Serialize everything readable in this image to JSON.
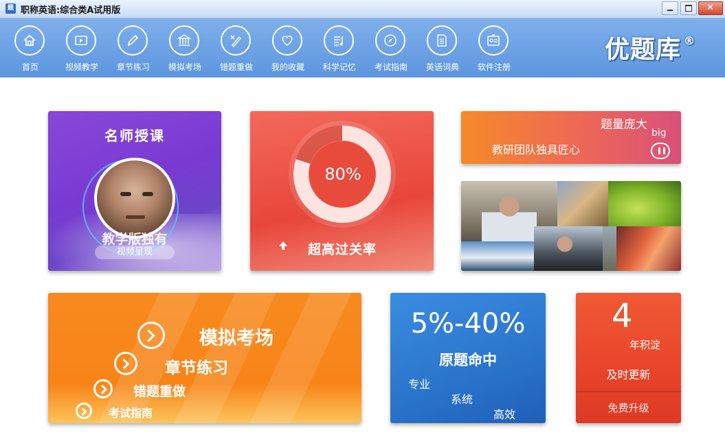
{
  "window": {
    "title": "职称英语:综合类A试用版",
    "app_icon_text": "题"
  },
  "nav": [
    {
      "label": "首页",
      "icon": "home-icon"
    },
    {
      "label": "视频教学",
      "icon": "video-icon"
    },
    {
      "label": "章节练习",
      "icon": "pencil-icon"
    },
    {
      "label": "模拟考场",
      "icon": "building-icon"
    },
    {
      "label": "错题重做",
      "icon": "wrong-answer-icon"
    },
    {
      "label": "我的收藏",
      "icon": "heart-icon"
    },
    {
      "label": "科学记忆",
      "icon": "list-icon"
    },
    {
      "label": "考试指南",
      "icon": "compass-icon"
    },
    {
      "label": "英语词典",
      "icon": "document-icon"
    },
    {
      "label": "软件注册",
      "icon": "id-card-icon"
    }
  ],
  "logo": {
    "text": "优题库",
    "mark": "®"
  },
  "tiles": {
    "teacher": {
      "title": "名师授课",
      "subtitle": "教学版独有",
      "pill": "视频呈现"
    },
    "pass_rate": {
      "percent_label": "80%",
      "percent": 80,
      "caption": "超高过关率"
    },
    "banner": {
      "line1": "题量庞大",
      "line1_suffix": "big",
      "line2": "教研团队独具匠心"
    },
    "practice": {
      "items": [
        "模拟考场",
        "章节练习",
        "错题重做",
        "考试指南"
      ]
    },
    "hit_rate": {
      "range": "5%-40%",
      "caption": "原题命中",
      "words": [
        "专业",
        "系统",
        "高效"
      ]
    },
    "update": {
      "number": "4",
      "unit": "年积淀",
      "line2": "及时更新",
      "line3": "免费升级"
    }
  }
}
